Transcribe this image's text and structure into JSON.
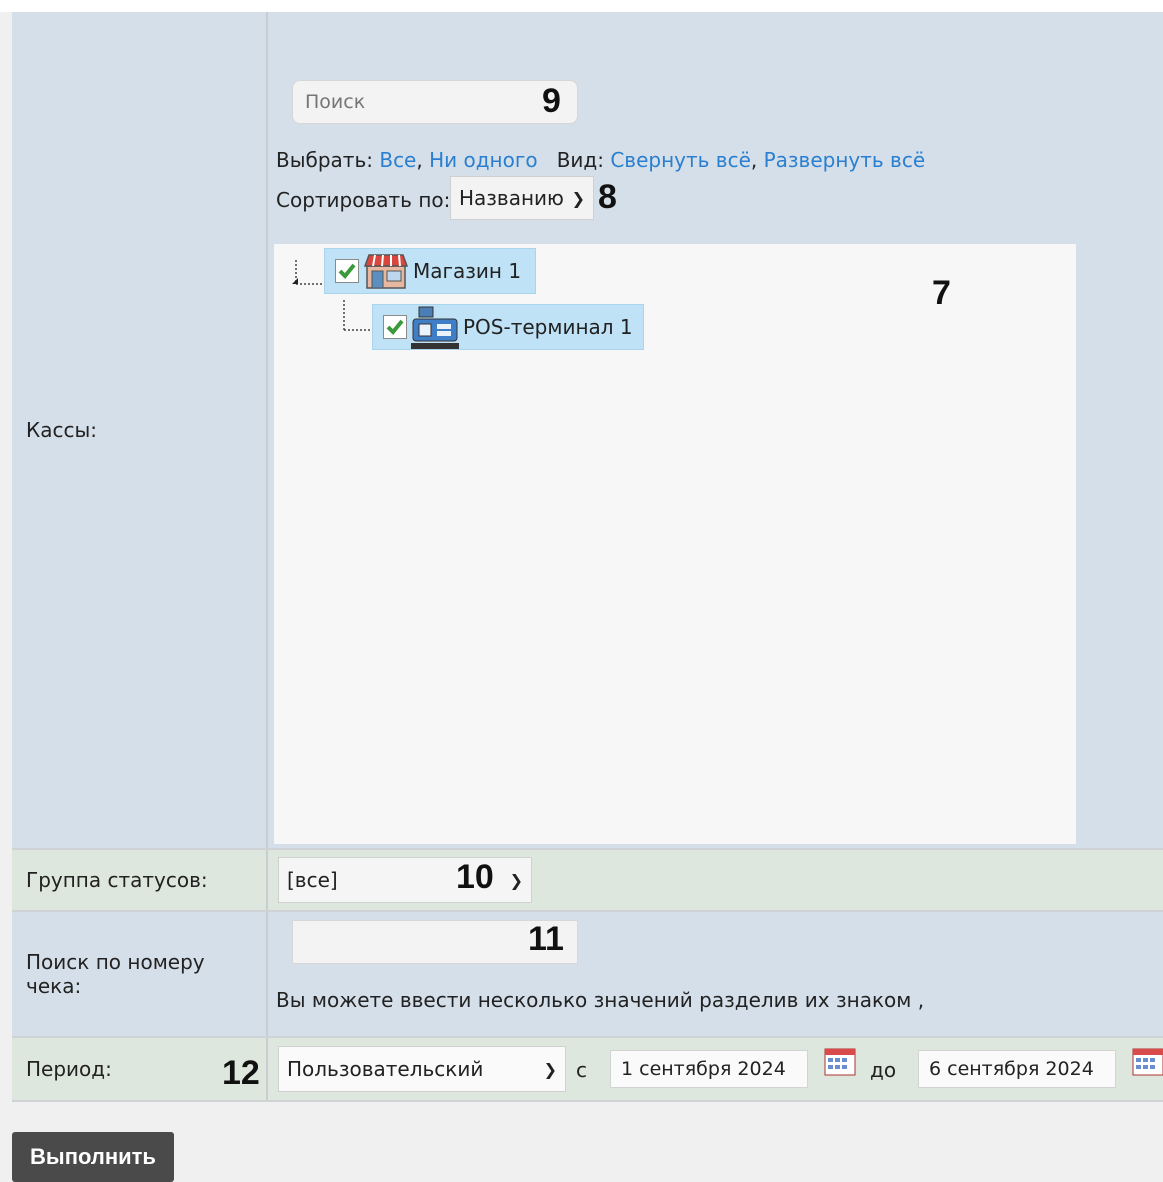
{
  "kassy": {
    "label": "Кассы:",
    "search_placeholder": "Поиск",
    "select_prefix": "Выбрать:",
    "select_all": "Все",
    "select_none": "Ни одного",
    "view_prefix": "Вид:",
    "collapse_all": "Свернуть всё",
    "expand_all": "Развернуть всё",
    "sort_label": "Сортировать по:",
    "sort_value": "Названию",
    "tree": [
      {
        "label": "Магазин 1",
        "checked": true,
        "icon": "shop-icon"
      },
      {
        "label": "POS-терминал 1",
        "checked": true,
        "icon": "pos-terminal-icon"
      }
    ]
  },
  "status_group": {
    "label": "Группа статусов:",
    "value": "[все]"
  },
  "check_search": {
    "label": "Поиск по номеру чека:",
    "value": "",
    "hint": "Вы можете ввести несколько значений разделив их знаком ,"
  },
  "period": {
    "label": "Период:",
    "value": "Пользовательский",
    "from_label": "с",
    "from_date": "1 сентября 2024",
    "to_label": "до",
    "to_date": "6 сентября 2024"
  },
  "run_button": "Выполнить",
  "annotations": {
    "n7": "7",
    "n8": "8",
    "n9": "9",
    "n10": "10",
    "n11": "11",
    "n12": "12"
  }
}
